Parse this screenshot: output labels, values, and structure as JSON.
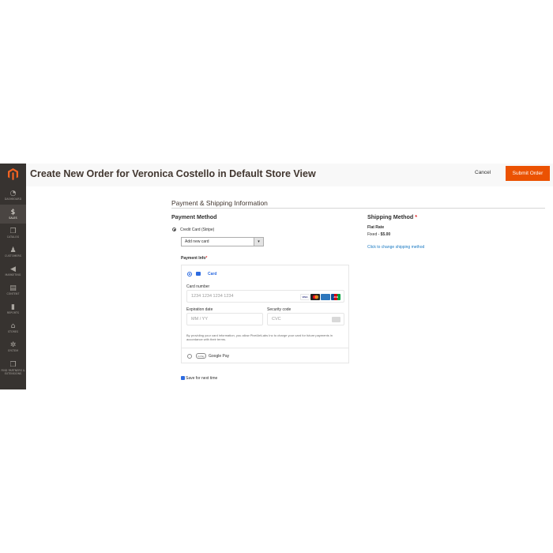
{
  "header": {
    "title": "Create New Order for Veronica Costello in Default Store View",
    "cancel_label": "Cancel",
    "submit_label": "Submit Order"
  },
  "sidebar": {
    "items": [
      {
        "label": "DASHBOARD",
        "icon": "dashboard-icon"
      },
      {
        "label": "SALES",
        "icon": "dollar-icon",
        "active": true
      },
      {
        "label": "CATALOG",
        "icon": "cube-icon"
      },
      {
        "label": "CUSTOMERS",
        "icon": "person-icon"
      },
      {
        "label": "MARKETING",
        "icon": "megaphone-icon"
      },
      {
        "label": "CONTENT",
        "icon": "content-icon"
      },
      {
        "label": "REPORTS",
        "icon": "bar-chart-icon"
      },
      {
        "label": "STORES",
        "icon": "store-icon"
      },
      {
        "label": "SYSTEM",
        "icon": "gear-icon"
      },
      {
        "label": "FIND PARTNERS & EXTENSIONS",
        "icon": "partners-icon"
      }
    ]
  },
  "section": {
    "title": "Payment & Shipping Information"
  },
  "payment": {
    "heading": "Payment Method",
    "method_label": "Credit Card (Stripe)",
    "select_value": "Add new card",
    "info_label": "Payment Info",
    "card_tab_label": "Card",
    "card_number_label": "Card number",
    "card_number_placeholder": "1234 1234 1234 1234",
    "expiry_label": "Expiration date",
    "expiry_placeholder": "MM / YY",
    "cvc_label": "Security code",
    "cvc_placeholder": "CVC",
    "disclaimer": "By providing your card information, you allow PixelArtLabs Inc to charge your card for future payments in accordance with their terms.",
    "gpay_badge": "G Pay",
    "gpay_label": "Google Pay",
    "save_label": "Save for next time",
    "card_brands": [
      "VISA",
      "MC",
      "AMEX",
      "JCB"
    ]
  },
  "shipping": {
    "heading": "Shipping Method",
    "rate_name": "Flat Rate",
    "rate_prefix": "Fixed - ",
    "rate_price": "$5.00",
    "change_link": "Click to change shipping method"
  },
  "colors": {
    "accent": "#eb5202",
    "sidebar_bg": "#373330",
    "stripe_blue": "#2d6be0",
    "link": "#1979c3"
  }
}
